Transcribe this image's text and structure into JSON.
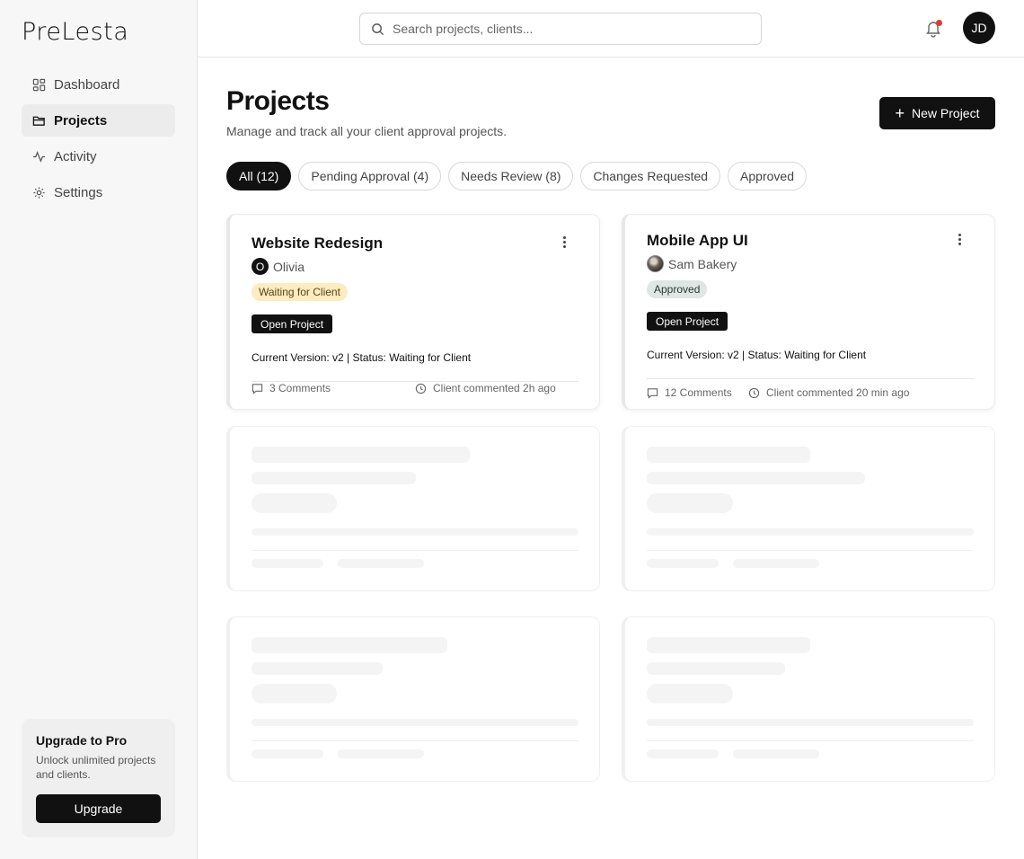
{
  "app": {
    "logo": "PreLesta"
  },
  "sidebar": {
    "items": [
      {
        "label": "Dashboard",
        "icon": "grid-icon",
        "active": false
      },
      {
        "label": "Projects",
        "icon": "folder-icon",
        "active": true
      },
      {
        "label": "Activity",
        "icon": "activity-icon",
        "active": false
      },
      {
        "label": "Settings",
        "icon": "gear-icon",
        "active": false
      }
    ],
    "upgrade": {
      "title": "Upgrade to Pro",
      "text": "Unlock unlimited projects and clients.",
      "button": "Upgrade"
    }
  },
  "header": {
    "search_placeholder": "Search projects, clients...",
    "notification_dot_color": "#e53935",
    "avatar_initials": "JD"
  },
  "main": {
    "title": "Projects",
    "subtitle": "Manage and track all your client approval projects.",
    "new_project_label": "New Project",
    "filters": [
      {
        "label": "All (12)",
        "active": true
      },
      {
        "label": "Pending Approval (4)",
        "active": false
      },
      {
        "label": "Needs Review (8)",
        "active": false
      },
      {
        "label": "Changes Requested",
        "active": false
      },
      {
        "label": "Approved",
        "active": false
      }
    ],
    "projects": [
      {
        "title": "Website Redesign",
        "client_initial": "O",
        "client": "Olivia",
        "status": "Waiting for Client",
        "status_color": "#fdecc0",
        "open_label": "Open Project",
        "version_line": "Current Version: v2 | Status: Waiting for Client",
        "comments": "3 Comments",
        "last_activity": "Client commented 2h ago"
      },
      {
        "title": "Mobile App UI",
        "client": "Sam Bakery",
        "status": "Approved",
        "status_color": "#dfe6e3",
        "open_label": "Open Project",
        "version_line": "Current Version: v2 | Status: Waiting for Client",
        "comments": "12 Comments",
        "last_activity": "Client commented 20 min ago"
      }
    ]
  }
}
